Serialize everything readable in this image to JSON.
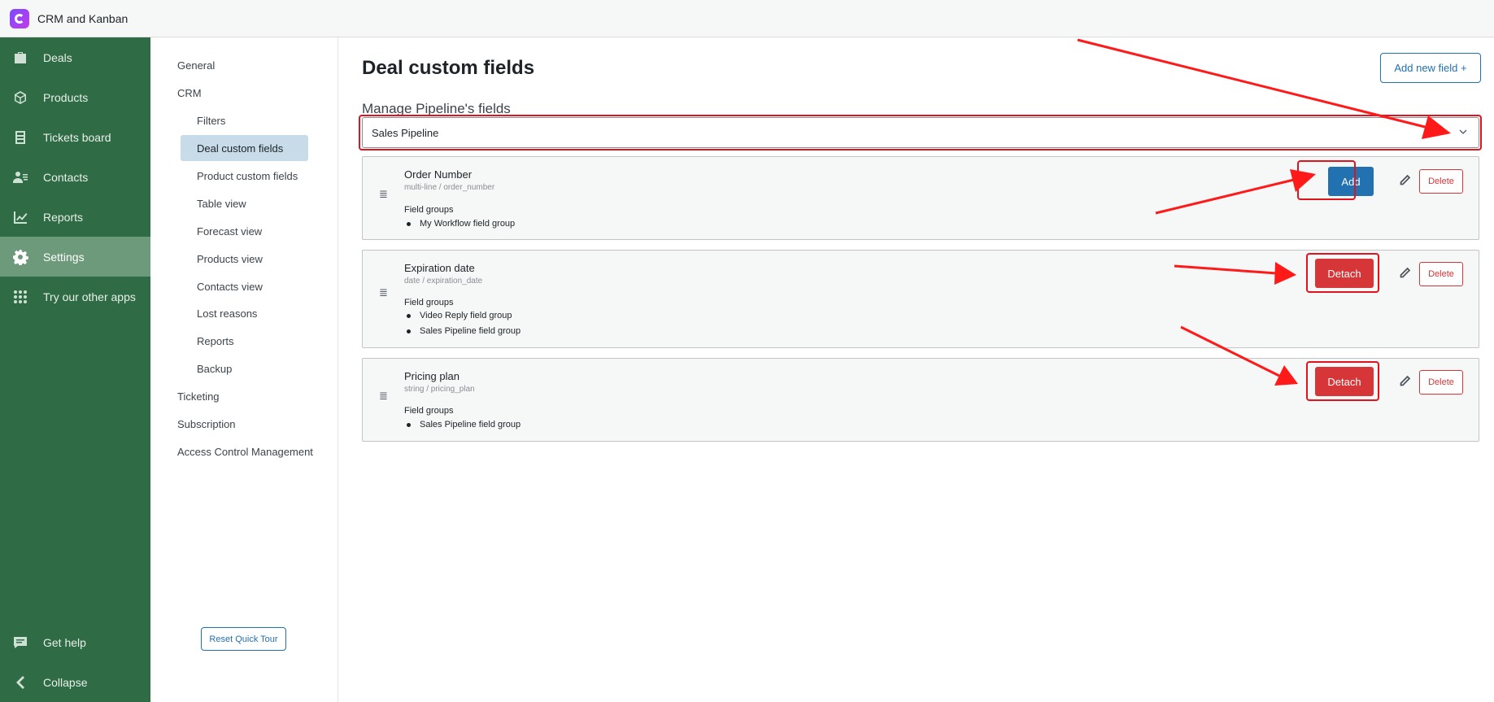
{
  "app": {
    "title": "CRM and Kanban"
  },
  "sidebar": {
    "items": [
      {
        "label": "Deals",
        "icon": "briefcase-icon"
      },
      {
        "label": "Products",
        "icon": "cube-icon"
      },
      {
        "label": "Tickets board",
        "icon": "inbox-icon"
      },
      {
        "label": "Contacts",
        "icon": "contacts-icon"
      },
      {
        "label": "Reports",
        "icon": "chart-icon"
      },
      {
        "label": "Settings",
        "icon": "gear-icon",
        "active": true
      },
      {
        "label": "Try our other apps",
        "icon": "grid-icon"
      }
    ],
    "bottom": [
      {
        "label": "Get help",
        "icon": "chat-icon"
      },
      {
        "label": "Collapse",
        "icon": "chevron-left-icon"
      }
    ]
  },
  "subnav": {
    "general": "General",
    "crm": "CRM",
    "filters": "Filters",
    "deal_custom_fields": "Deal custom fields",
    "product_custom_fields": "Product custom fields",
    "table_view": "Table view",
    "forecast_view": "Forecast view",
    "products_view": "Products view",
    "contacts_view": "Contacts view",
    "lost_reasons": "Lost reasons",
    "reports": "Reports",
    "backup": "Backup",
    "ticketing": "Ticketing",
    "subscription": "Subscription",
    "access_control": "Access Control Management",
    "reset_tour": "Reset Quick Tour"
  },
  "main": {
    "title": "Deal custom fields",
    "add_new_field": "Add new field +",
    "section_title": "Manage Pipeline's fields",
    "pipeline_selected": "Sales Pipeline",
    "field_groups_label": "Field groups",
    "delete_label": "Delete",
    "fields": [
      {
        "name": "Order Number",
        "meta": "multi-line / order_number",
        "groups": [
          "My Workflow field group"
        ],
        "action": "Add"
      },
      {
        "name": "Expiration date",
        "meta": "date / expiration_date",
        "groups": [
          "Video Reply field group",
          "Sales Pipeline field group"
        ],
        "action": "Detach"
      },
      {
        "name": "Pricing plan",
        "meta": "string / pricing_plan",
        "groups": [
          "Sales Pipeline field group"
        ],
        "action": "Detach"
      }
    ]
  },
  "colors": {
    "sidebar_bg": "#2f6b45",
    "sidebar_active": "#6d9a7a",
    "primary_blue": "#2271b1",
    "danger_red": "#d63638",
    "annotation_red": "#e0141e"
  }
}
